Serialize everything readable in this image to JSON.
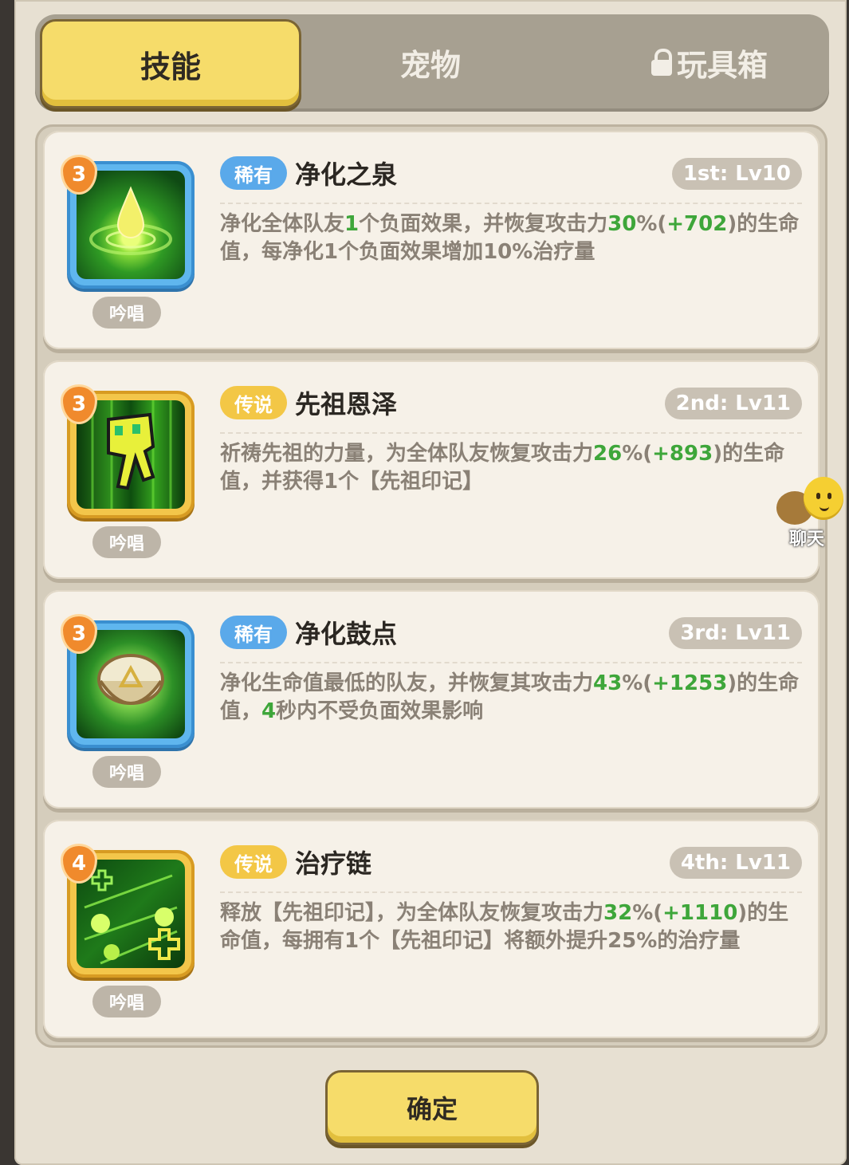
{
  "tabs": {
    "skills": "技能",
    "pets": "宠物",
    "toybox": "玩具箱"
  },
  "skills": [
    {
      "count": "3",
      "rarity": "稀有",
      "name": "净化之泉",
      "level": "1st: Lv10",
      "cast_type": "吟唱",
      "desc_parts": [
        {
          "t": "净化全体队友",
          "h": false
        },
        {
          "t": "1",
          "h": true
        },
        {
          "t": "个负面效果，并恢复攻击力",
          "h": false
        },
        {
          "t": "30",
          "h": true
        },
        {
          "t": "%(",
          "h": false
        },
        {
          "t": "+702",
          "h": true
        },
        {
          "t": ")的生命值，每净化1个负面效果增加10%治疗量",
          "h": false
        }
      ]
    },
    {
      "count": "3",
      "rarity": "传说",
      "name": "先祖恩泽",
      "level": "2nd: Lv11",
      "cast_type": "吟唱",
      "desc_parts": [
        {
          "t": "祈祷先祖的力量，为全体队友恢复攻击力",
          "h": false
        },
        {
          "t": "26",
          "h": true
        },
        {
          "t": "%(",
          "h": false
        },
        {
          "t": "+893",
          "h": true
        },
        {
          "t": ")的生命值，并获得1个【先祖印记】",
          "h": false
        }
      ]
    },
    {
      "count": "3",
      "rarity": "稀有",
      "name": "净化鼓点",
      "level": "3rd: Lv11",
      "cast_type": "吟唱",
      "desc_parts": [
        {
          "t": "净化生命值最低的队友，并恢复其攻击力",
          "h": false
        },
        {
          "t": "43",
          "h": true
        },
        {
          "t": "%(",
          "h": false
        },
        {
          "t": "+1253",
          "h": true
        },
        {
          "t": ")的生命值，",
          "h": false
        },
        {
          "t": "4",
          "h": true
        },
        {
          "t": "秒内不受负面效果影响",
          "h": false
        }
      ]
    },
    {
      "count": "4",
      "rarity": "传说",
      "name": "治疗链",
      "level": "4th: Lv11",
      "cast_type": "吟唱",
      "desc_parts": [
        {
          "t": "释放【先祖印记】，为全体队友恢复攻击力",
          "h": false
        },
        {
          "t": "32",
          "h": true
        },
        {
          "t": "%(",
          "h": false
        },
        {
          "t": "+1110",
          "h": true
        },
        {
          "t": ")的生命值，每拥有1个【先祖印记】将额外提升25%的治疗量",
          "h": false
        }
      ]
    }
  ],
  "chat": {
    "label": "聊天"
  },
  "confirm": {
    "label": "确定"
  },
  "colors": {
    "rare": "#5aa9ea",
    "legendary": "#f3c746",
    "highlight": "#3ea63a"
  }
}
